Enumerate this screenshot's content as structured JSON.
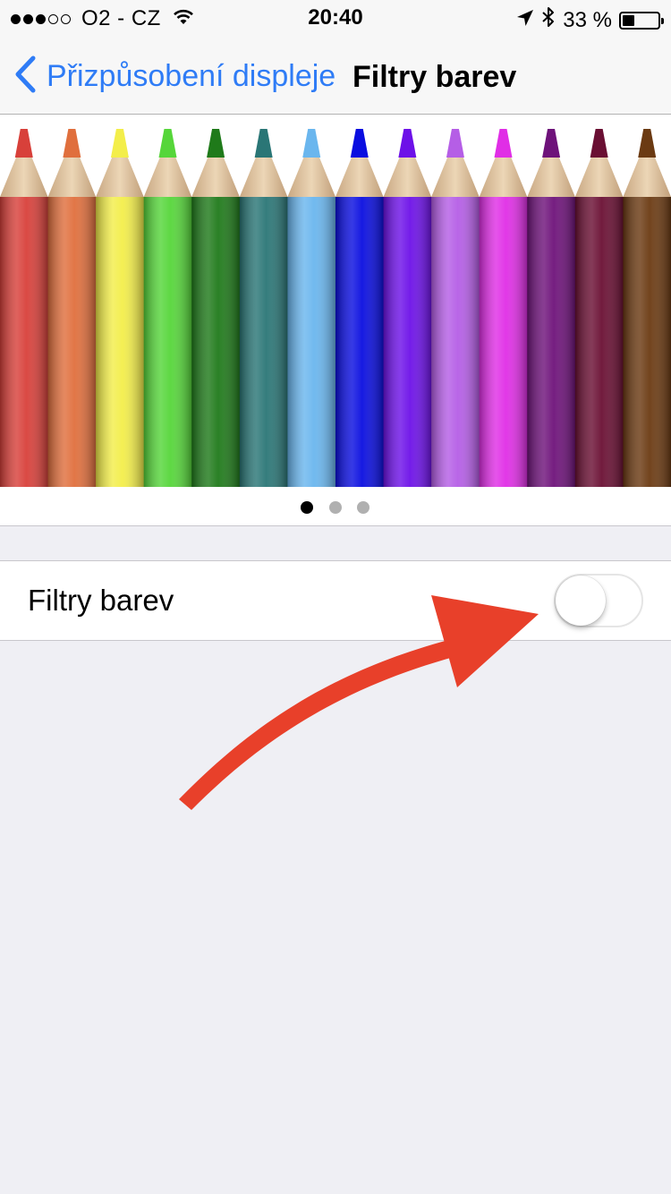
{
  "status_bar": {
    "signal_filled": 3,
    "signal_empty": 2,
    "carrier": "O2 - CZ",
    "time": "20:40",
    "battery_percent_label": "33 %",
    "battery_level": 0.33
  },
  "nav": {
    "back_label": "Přizpůsobení displeje",
    "title": "Filtry barev"
  },
  "pencil_colors": [
    "#d8403a",
    "#e06f3d",
    "#f3ee4a",
    "#56d63a",
    "#1f7a1a",
    "#2a7676",
    "#6ab6ee",
    "#0a0ee0",
    "#6d11e8",
    "#b55ee6",
    "#e02ee6",
    "#6e127a",
    "#6a0f33",
    "#6b3a12"
  ],
  "pager": {
    "count": 3,
    "active_index": 0
  },
  "settings": {
    "color_filters_label": "Filtry barev",
    "color_filters_enabled": false
  },
  "colors": {
    "accent": "#2f7cf6",
    "annotation_arrow": "#e8402a",
    "background": "#efeff4"
  },
  "icons": [
    "chevron-left-icon",
    "wifi-icon",
    "location-arrow-icon",
    "bluetooth-icon",
    "battery-icon"
  ]
}
